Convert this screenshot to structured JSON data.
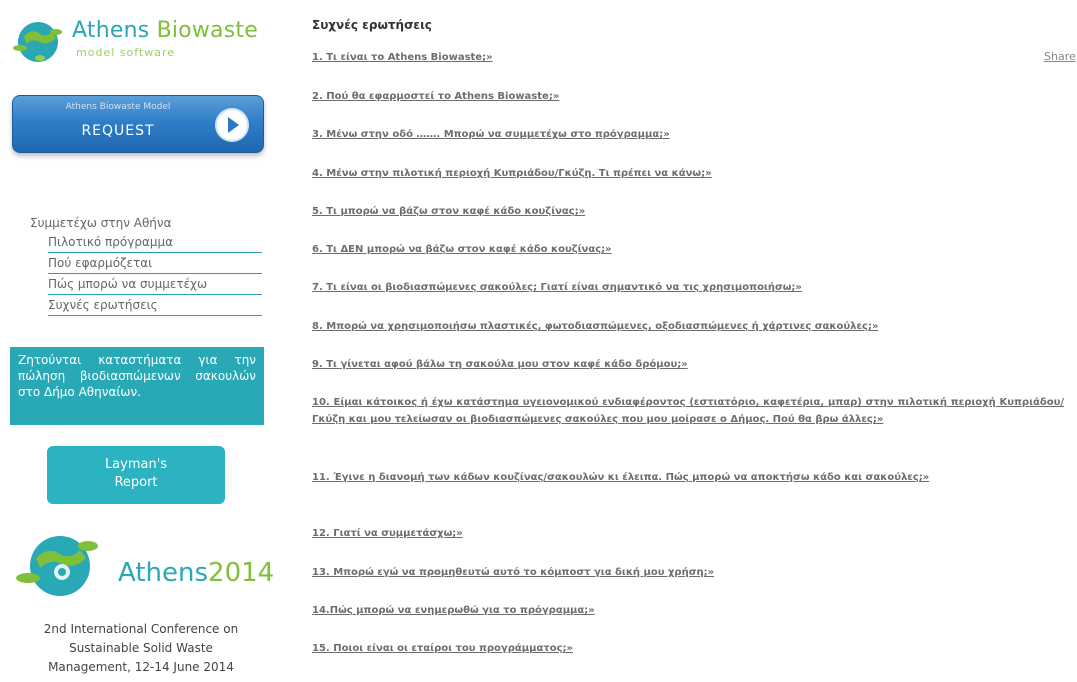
{
  "sidebar": {
    "logo": {
      "brand_part1": "Athens ",
      "brand_part2": "Biowaste",
      "tagline": "model software"
    },
    "request_button": {
      "small_label": "Athens Biowaste Model",
      "label": "REQUEST"
    },
    "nav": {
      "heading": "Συμμετέχω στην Αθήνα",
      "items": [
        {
          "label": "Πιλοτικό πρόγραμμα"
        },
        {
          "label": "Πού εφαρμόζεται"
        },
        {
          "label": "Πώς μπορώ να συμμετέχω"
        },
        {
          "label": "Συχνές ερωτήσεις"
        }
      ]
    },
    "notice": "Ζητούνται καταστήματα για την πώληση βιοδιασπώμενων σακουλών στο Δήμο Αθηναίων.",
    "layman_button": {
      "line1": "Layman's",
      "line2": "Report"
    },
    "athens2014": {
      "brand": "Athens",
      "year": "2014"
    },
    "conference": {
      "line1": "2nd International Conference on",
      "line2": "Sustainable Solid Waste",
      "line3": "Management, 12-14 June 2014"
    }
  },
  "main": {
    "title": "Συχνές ερωτήσεις",
    "share_label": "Share",
    "faqs": [
      {
        "text": "1. Τι είναι το Athens Biowaste;»"
      },
      {
        "text": "2. Πού θα εφαρμοστεί το Athens Biowaste;»"
      },
      {
        "text": "3. Μένω στην οδό ……. Μπορώ να συμμετέχω στο πρόγραμμα;»"
      },
      {
        "text": "4. Μένω στην πιλοτική περιοχή Κυπριάδου/Γκύζη. Τι πρέπει να κάνω;»"
      },
      {
        "text": "5. Τι μπορώ να βάζω στον καφέ κάδο κουζίνας;»"
      },
      {
        "text": "6. Τι ΔΕΝ μπορώ να βάζω στον καφέ κάδο κουζίνας;»"
      },
      {
        "text": "7. Τι είναι οι βιοδιασπώμενες σακούλες; Γιατί είναι σημαντικό να τις χρησιμοποιήσω;»"
      },
      {
        "text": "8. Μπορώ να χρησιμοποιήσω πλαστικές, φωτοδιασπώμενες, οξοδιασπώμενες ή χάρτινες σακούλες;»"
      },
      {
        "text": "9. Τι γίνεται αφού βάλω τη σακούλα μου στον καφέ κάδο δρόμου;»"
      },
      {
        "text": "10. Είμαι κάτοικος ή έχω κατάστημα υγειονομικού ενδιαφέροντος (εστιατόριο, καφετέρια, μπαρ) στην πιλοτική περιοχή Κυπριάδου/Γκύζη και μου τελείωσαν οι βιοδιασπώμενες σακούλες που μου μοίρασε ο Δήμος. Πού θα βρω άλλες;»"
      },
      {
        "text": "11. Έγινε η διανομή των κάδων κουζίνας/σακουλών κι έλειπα. Πώς μπορώ να αποκτήσω κάδο και σακούλες;»"
      },
      {
        "text": "12. Γιατί να συμμετάσχω;»"
      },
      {
        "text": "13. Μπορώ εγώ να προμηθευτώ αυτό το κόμποστ για δική μου χρήση;»"
      },
      {
        "text": "14.Πώς μπορώ να ενημερωθώ για το πρόγραμμα;»"
      },
      {
        "text": "15. Ποιοι είναι οι εταίροι του προγράμματος;»"
      }
    ]
  },
  "colors": {
    "accent_teal": "#29a9b6",
    "accent_green": "#7fbf3a",
    "request_blue": "#2f7ec8"
  }
}
